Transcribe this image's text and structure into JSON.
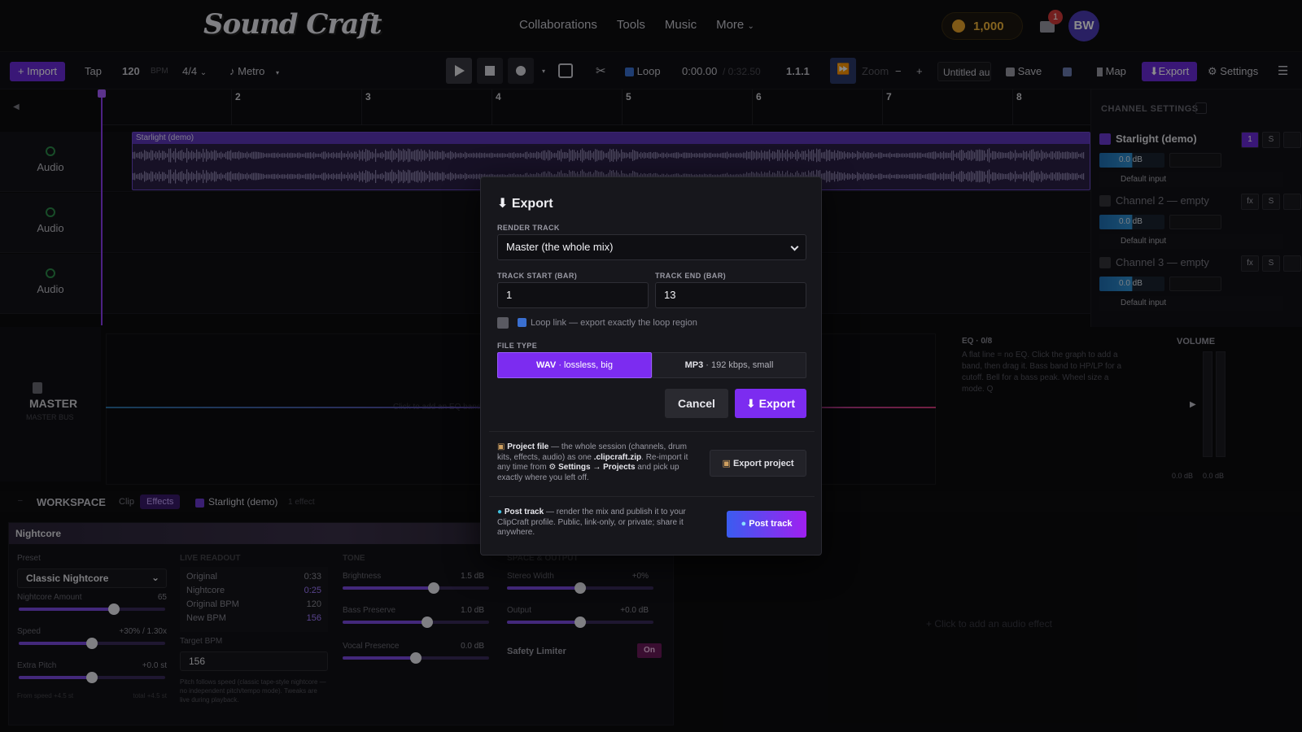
{
  "app": {
    "logo": "Sound Craft",
    "nav": [
      "Collaborations",
      "Tools",
      "Music",
      "More"
    ],
    "coins": "1,000",
    "notifications": "1",
    "avatar": "BW"
  },
  "toolbar": {
    "import": "+ Import",
    "tap": "Tap",
    "bpm": "120",
    "bpm_unit": "BPM",
    "time_sig": "4/4",
    "metro": "Metro",
    "loop": "Loop",
    "time": "0:00.00",
    "time_total": "/ 0:32.50",
    "position": "1.1.1",
    "zoom": "Zoom",
    "zoom_minus": "−",
    "zoom_plus": "+",
    "project_name": "Untitled au",
    "save": "Save",
    "map": "Map",
    "export": "Export",
    "settings": "Settings"
  },
  "ruler": {
    "bars": [
      "2",
      "3",
      "4",
      "5",
      "6",
      "7",
      "8"
    ]
  },
  "tracks": [
    {
      "label": "Audio"
    },
    {
      "label": "Audio"
    },
    {
      "label": "Audio"
    }
  ],
  "clip": {
    "title": "Starlight (demo)"
  },
  "channel_settings": {
    "header": "CHANNEL SETTINGS",
    "channels": [
      {
        "name": "Starlight (demo)",
        "b1": "1",
        "b2": "S",
        "db": "0.0 dB",
        "input": "Default input",
        "color": "#6a3ad0"
      },
      {
        "name": "Channel 2 — empty",
        "b1": "fx",
        "b2": "S",
        "db": "0.0 dB",
        "input": "Default input",
        "color": "#333339"
      },
      {
        "name": "Channel 3 — empty",
        "b1": "fx",
        "b2": "S",
        "db": "0.0 dB",
        "input": "Default input",
        "color": "#333339"
      }
    ]
  },
  "master": {
    "label": "MASTER",
    "sub": "MASTER BUS",
    "eq_title": "EQ · 0/8",
    "eq_help": "A flat line = no EQ. Click the graph to add a band, then drag it. Bass band to HP/LP for a cutoff. Bell for a bass peak. Wheel size a mode. Q",
    "eq_hint": "Click to add an EQ band",
    "volume": "VOLUME",
    "vol_db1": "0.0 dB",
    "vol_db2": "0.0 dB"
  },
  "workspace": {
    "label": "WORKSPACE",
    "tab_clip": "Clip",
    "tab_effects": "Effects",
    "track": "Starlight (demo)",
    "count": "1 effect",
    "add_effect": "Click to add an audio effect",
    "effect": {
      "name": "Nightcore",
      "preset_label": "Preset",
      "preset": "Classic Nightcore",
      "amount_label": "Nightcore Amount",
      "amount": "65",
      "speed_label": "Speed",
      "speed": "+30% / 1.30x",
      "pitch_label": "Extra Pitch",
      "pitch": "+0.0 st",
      "from_speed": "From speed +4.5 st",
      "total": "total +4.5 st",
      "readout_label": "LIVE READOUT",
      "readout": [
        {
          "k": "Original",
          "v": "0:33"
        },
        {
          "k": "Nightcore",
          "v": "0:25"
        },
        {
          "k": "Original BPM",
          "v": "120"
        },
        {
          "k": "New BPM",
          "v": "156"
        }
      ],
      "target_label": "Target BPM",
      "target": "156",
      "note": "Pitch follows speed (classic tape-style nightcore — no independent pitch/tempo mode). Tweaks are live during playback.",
      "tone_label": "TONE",
      "brightness_label": "Brightness",
      "brightness": "1.5 dB",
      "bass_label": "Bass Preserve",
      "bass": "1.0 dB",
      "vocal_label": "Vocal Presence",
      "vocal": "0.0 dB",
      "space_label": "SPACE & OUTPUT",
      "width_label": "Stereo Width",
      "width": "+0%",
      "output_label": "Output",
      "output": "+0.0 dB",
      "limiter_label": "Safety Limiter",
      "limiter": "On",
      "levels": {
        "amount": 0.65,
        "speed": 0.5,
        "pitch": 0.5,
        "brightness": 0.62,
        "bass": 0.58,
        "vocal": 0.5,
        "width": 0.5,
        "output": 0.5
      }
    }
  },
  "modal": {
    "title": "Export",
    "render_label": "RENDER TRACK",
    "render_value": "Master (the whole mix)",
    "start_label": "TRACK START (BAR)",
    "start_value": "1",
    "end_label": "TRACK END (BAR)",
    "end_value": "13",
    "loop_link": "Loop link — export exactly the loop region",
    "filetype_label": "FILE TYPE",
    "wav_bold": "WAV",
    "wav_rest": " · lossless, big",
    "mp3_bold": "MP3",
    "mp3_rest": " · 192 kbps, small",
    "cancel": "Cancel",
    "export": "Export",
    "project_title": "Project file",
    "project_desc1": " — the whole session (channels, drum kits, effects, audio) as one ",
    "project_file": ".clipcraft.zip",
    "project_desc2": ". Re-import it any time from ",
    "project_path": "⚙ Settings → Projects",
    "project_desc3": " and pick up exactly where you left off.",
    "export_project": "Export project",
    "post_title": "Post track",
    "post_desc": " — render the mix and publish it to your ClipCraft profile. Public, link-only, or private; share it anywhere.",
    "post_button": "Post track"
  }
}
